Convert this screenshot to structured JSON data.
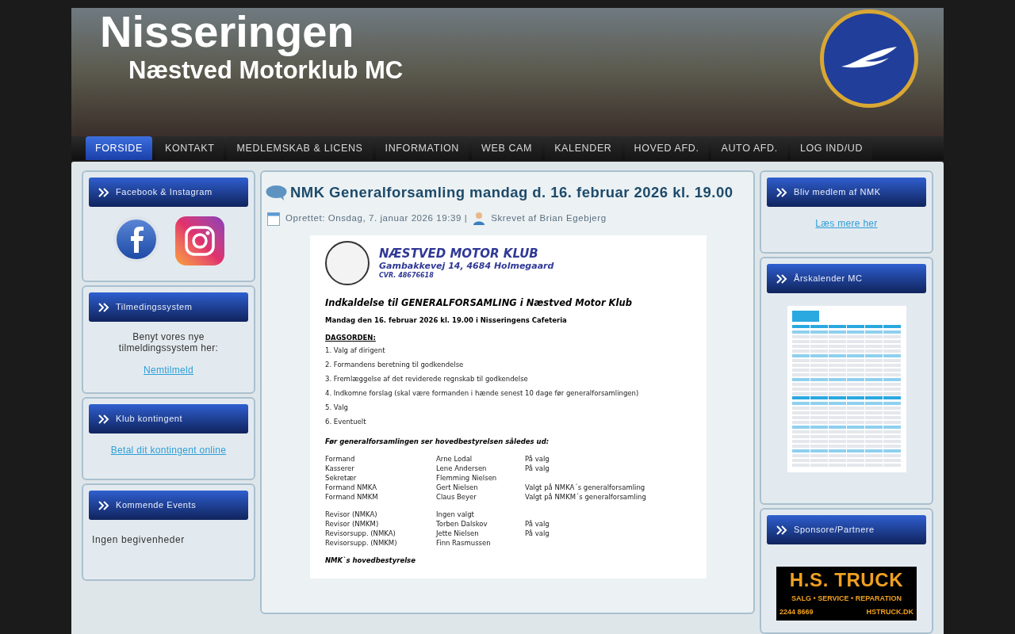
{
  "banner": {
    "title": "Nisseringen",
    "subtitle": "Næstved Motorklub MC"
  },
  "nav": [
    {
      "label": "FORSIDE",
      "selected": true
    },
    {
      "label": "KONTAKT",
      "selected": false
    },
    {
      "label": "MEDLEMSKAB & LICENS",
      "selected": false
    },
    {
      "label": "INFORMATION",
      "selected": false
    },
    {
      "label": "WEB CAM",
      "selected": false
    },
    {
      "label": "KALENDER",
      "selected": false
    },
    {
      "label": "HOVED AFD.",
      "selected": false
    },
    {
      "label": "AUTO AFD.",
      "selected": false
    },
    {
      "label": "LOG IND/UD",
      "selected": false
    }
  ],
  "left": [
    {
      "kind": "social",
      "title": "Facebook & Instagram"
    },
    {
      "kind": "text_link",
      "title": "Tilmedingssystem",
      "text": "Benyt vores nye tilmeldingssystem her:",
      "link": "Nemtilmeld"
    },
    {
      "kind": "link",
      "title": "Klub kontingent",
      "link": "Betal dit kontingent online"
    },
    {
      "kind": "text",
      "title": "Kommende Events",
      "text": "Ingen begivenheder"
    }
  ],
  "article": {
    "title": "NMK Generalforsamling mandag d. 16. februar 2026 kl. 19.00",
    "created": "Oprettet: Onsdag, 7. januar 2026 19:39 |",
    "author": "Skrevet af Brian Egebjerg",
    "document": {
      "club": "NÆSTVED MOTOR KLUB",
      "address": "Gambakkevej 14, 4684 Holmegaard",
      "cvr": "CVR. 48676618",
      "heading": "Indkaldelse til GENERALFORSAMLING i Næstved Motor Klub",
      "date": "Mandag den 16. februar 2026 kl. 19.00 i Nisseringens Cafeteria",
      "agenda_title": "DAGSORDEN:",
      "agenda": [
        "1. Valg af dirigent",
        "2. Formandens beretning til godkendelse",
        "3. Fremlæggelse af det reviderede regnskab til godkendelse",
        "4. Indkomne forslag (skal være formanden i hænde senest 10 dage før generalforsamlingen)",
        "5. Valg",
        "6. Eventuelt"
      ],
      "board_title": "Før generalforsamlingen ser hovedbestyrelsen således ud:",
      "board": [
        [
          {
            "role": "Formand",
            "name": "Arne Lodal",
            "note": "På valg"
          },
          {
            "role": "Kasserer",
            "name": "Lene Andersen",
            "note": "På valg"
          },
          {
            "role": "Sekretær",
            "name": "Flemming Nielsen"
          },
          {
            "role": "Formand NMKA",
            "name": "Gert Nielsen",
            "note": "Valgt på NMKA´s generalforsamling"
          },
          {
            "role": "Formand NMKM",
            "name": "Claus Beyer",
            "note": "Valgt på NMKM´s generalforsamling"
          }
        ],
        [
          {
            "role": "Revisor (NMKA)",
            "name": "Ingen valgt"
          },
          {
            "role": "Revisor (NMKM)",
            "name": "Torben Dalskov",
            "note": "På valg"
          },
          {
            "role": "Revisorsupp. (NMKA)",
            "name": "Jette Nielsen",
            "note": "På valg"
          },
          {
            "role": "Revisorsupp. (NMKM)",
            "name": "Finn Rasmussen"
          }
        ]
      ],
      "signature": "NMK`s hovedbestyrelse"
    }
  },
  "right": [
    {
      "kind": "link",
      "title": "Bliv medlem af NMK",
      "link": "Læs mere her"
    },
    {
      "kind": "calendar",
      "title": "Årskalender MC"
    },
    {
      "kind": "sponsor",
      "title": "Sponsore/Partnere",
      "sponsor": {
        "name": "H.S. TRUCK",
        "tagline": "SALG • SERVICE • REPARATION",
        "phone": "2244 8669",
        "web": "HSTRUCK.DK"
      }
    }
  ]
}
